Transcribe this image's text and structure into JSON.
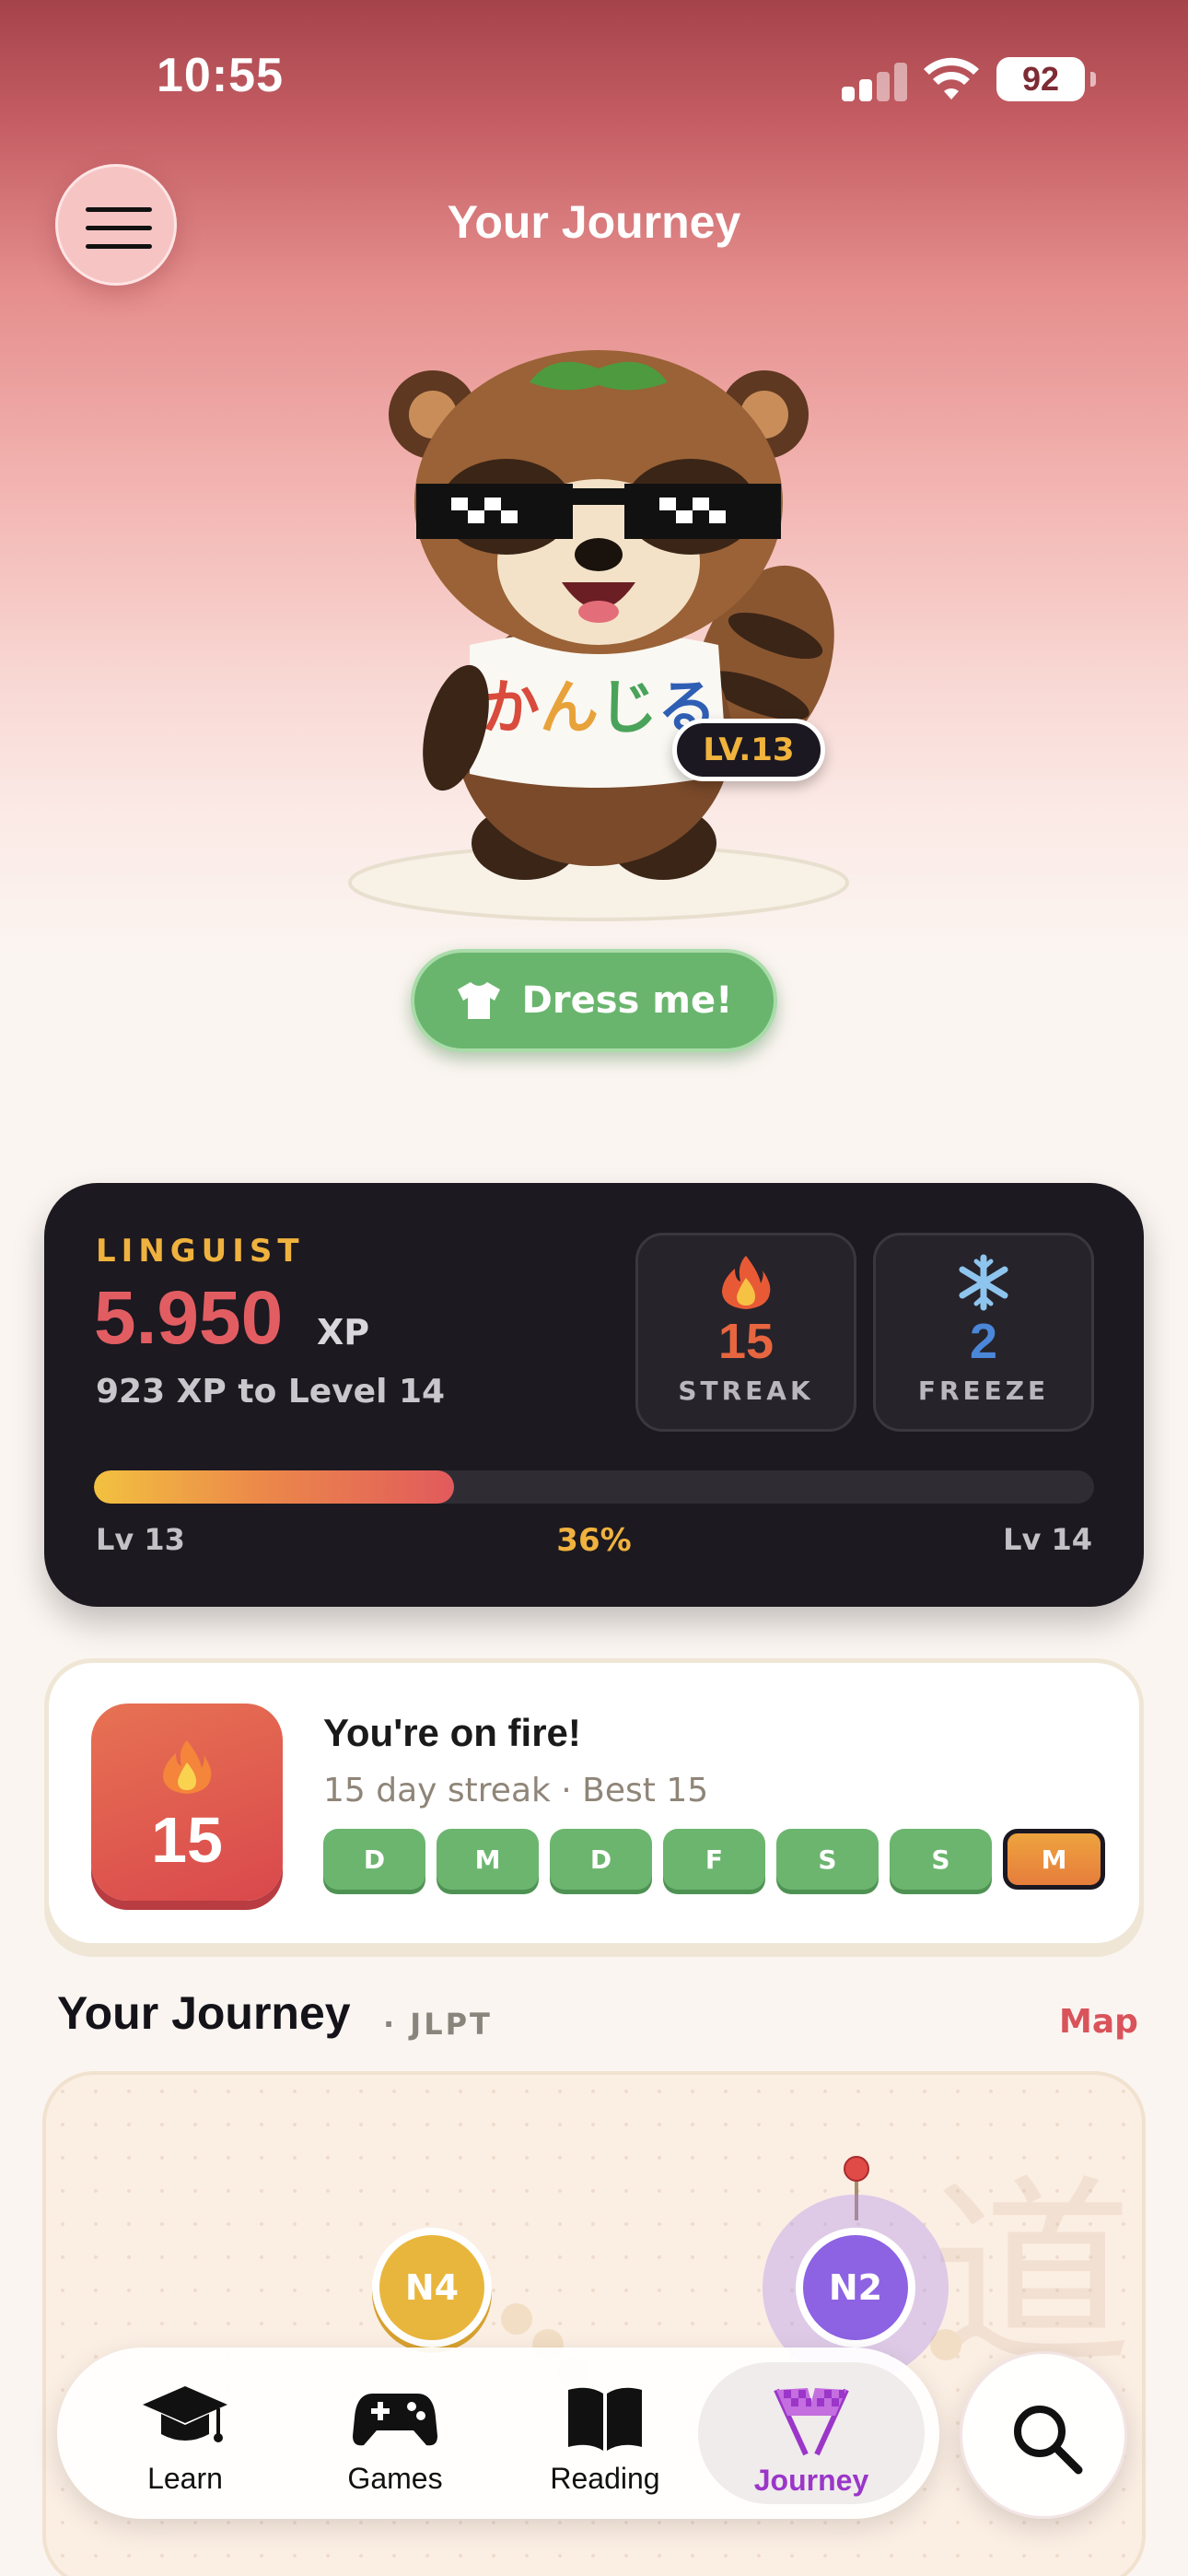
{
  "status_bar": {
    "time": "10:55",
    "battery": "92"
  },
  "header": {
    "title": "Your Journey"
  },
  "mascot": {
    "level_badge": "LV.13",
    "shirt_text": "かんじる",
    "dress_button": "Dress me!"
  },
  "stats": {
    "rank": "LINGUIST",
    "xp": "5.950",
    "xp_unit": "XP",
    "xp_to_next": "923 XP to Level 14",
    "streak": {
      "value": "15",
      "label": "STREAK"
    },
    "freeze": {
      "value": "2",
      "label": "FREEZE"
    },
    "progress": {
      "fraction": 0.36,
      "percent_label": "36%",
      "from_label": "Lv 13",
      "to_label": "Lv 14"
    }
  },
  "streak_card": {
    "count": "15",
    "title": "You're on fire!",
    "subtitle": "15 day streak · Best 15",
    "days": [
      "D",
      "M",
      "D",
      "F",
      "S",
      "S",
      "M"
    ]
  },
  "journey": {
    "title": "Your Journey",
    "tag": "· JLPT",
    "map_link": "Map",
    "kanji": "道",
    "nodes": {
      "n4": "N4",
      "n2": "N2"
    }
  },
  "tabbar": {
    "tabs": [
      {
        "label": "Learn",
        "icon": "graduation-cap-icon"
      },
      {
        "label": "Games",
        "icon": "gamepad-icon"
      },
      {
        "label": "Reading",
        "icon": "book-icon"
      },
      {
        "label": "Journey",
        "icon": "checkered-flags-icon"
      }
    ],
    "active": "Journey"
  },
  "colors": {
    "accent_red": "#e25d62",
    "gold": "#f0b23e",
    "green": "#6cb56f",
    "purple": "#9b36c9"
  }
}
